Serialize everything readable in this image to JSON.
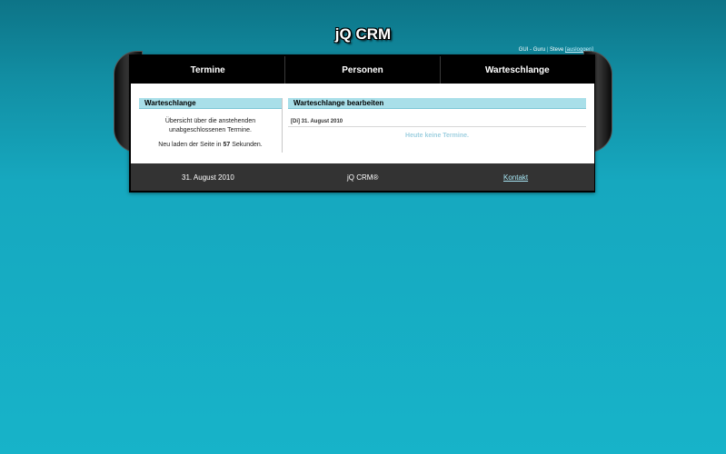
{
  "app": {
    "title": "jQ CRM"
  },
  "user": {
    "role": "GUI - Guru",
    "name": "Steve",
    "logout_label": "[ausloggen]"
  },
  "nav": {
    "items": [
      {
        "label": "Termine"
      },
      {
        "label": "Personen"
      },
      {
        "label": "Warteschlange"
      }
    ]
  },
  "left_panel": {
    "title": "Warteschlange",
    "description": "Übersicht über die anstehenden unabgeschlossenen Termine.",
    "reload_prefix": "Neu laden der Seite in",
    "reload_seconds": "57",
    "reload_suffix": "Sekunden."
  },
  "right_panel": {
    "title": "Warteschlange bearbeiten",
    "date_heading": "[Di] 31. August 2010",
    "empty_message": "Heute keine Termine."
  },
  "footer": {
    "date": "31. August 2010",
    "brand": "jQ CRM®",
    "contact_label": "Kontakt"
  },
  "colors": {
    "panel_header_bg": "#a9dfe9",
    "background_top": "#0d7487",
    "background_bottom": "#17b3c9",
    "footer_bg": "#333333"
  }
}
